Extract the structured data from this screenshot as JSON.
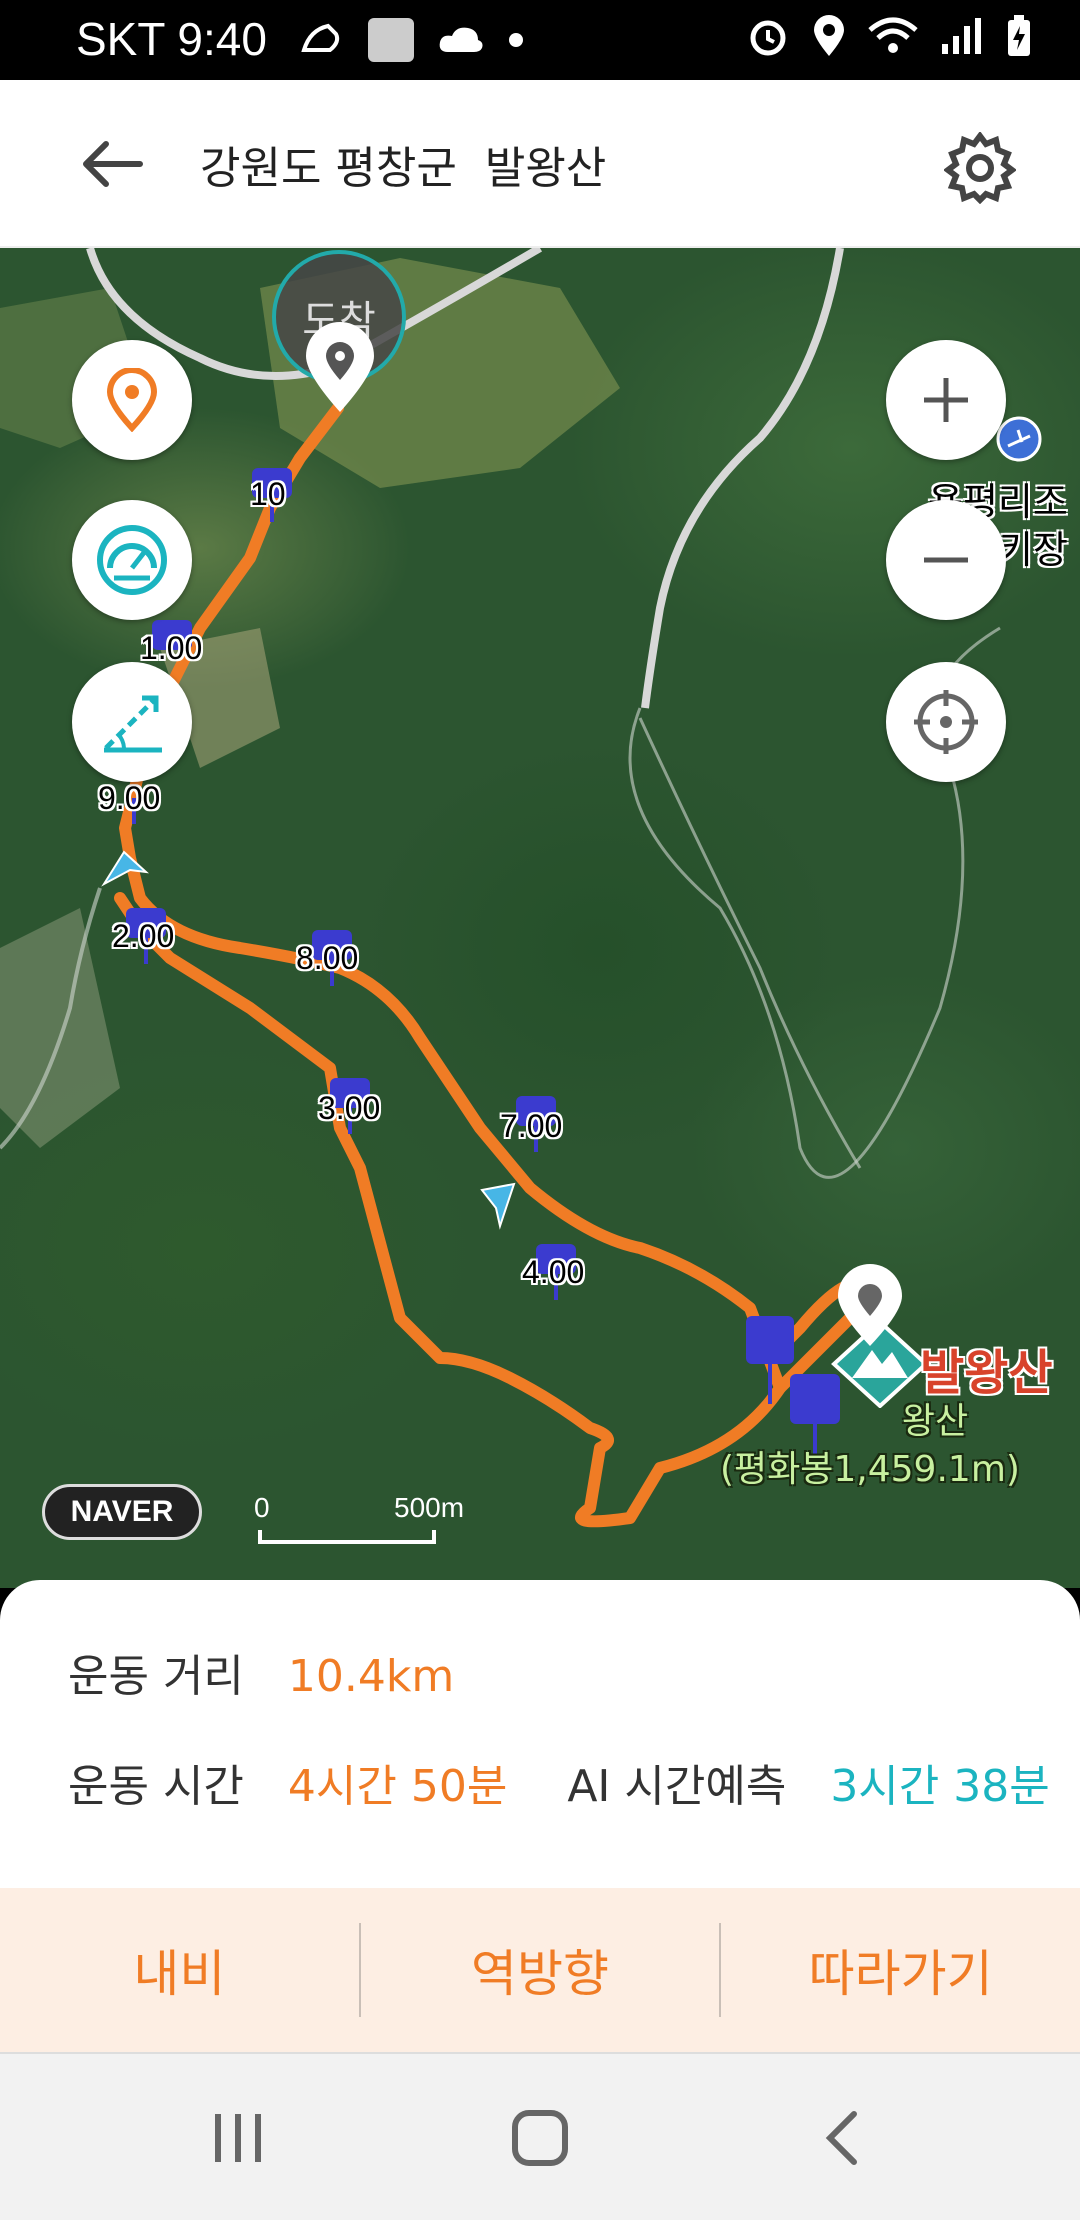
{
  "status_bar": {
    "carrier_time": "SKT 9:40"
  },
  "header": {
    "title": "강원도 평창군  발왕산"
  },
  "map": {
    "arrival_label": "도착",
    "km_markers": [
      "10",
      "1.00",
      "9.00",
      "2.00",
      "8.00",
      "3.00",
      "7.00",
      "4.00"
    ],
    "summit_name": "발왕산",
    "summit_sub_line1": "왕산",
    "summit_sub_line2": "(평화봉1,459.1m)",
    "place_line1": "용평리조",
    "place_line2": "키장",
    "naver_logo": "NAVER",
    "scale_start": "0",
    "scale_length": "500m"
  },
  "info": {
    "distance_label": "운동 거리",
    "distance_value": "10.4km",
    "time_label": "운동 시간",
    "time_value": "4시간 50분",
    "ai_label": "AI 시간예측",
    "ai_value": "3시간 38분"
  },
  "actions": {
    "navi": "내비",
    "reverse": "역방향",
    "follow": "따라가기"
  },
  "colors": {
    "accent_orange": "#f07c25",
    "accent_teal": "#1bb4c0",
    "marker_blue": "#3b3bcf"
  }
}
